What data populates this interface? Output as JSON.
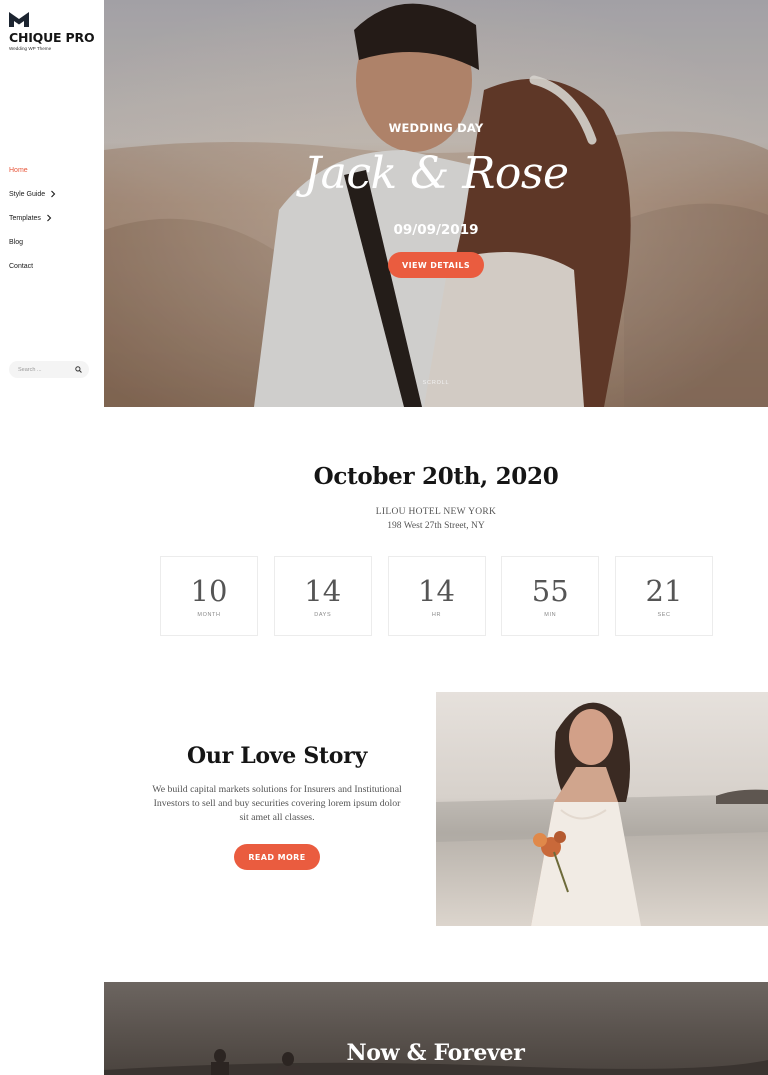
{
  "brand": {
    "name": "CHIQUE PRO",
    "tagline": "Wedding WP Theme",
    "accent": "#ea5c3f"
  },
  "nav": {
    "items": [
      {
        "label": "Home",
        "active": true,
        "has_submenu": false
      },
      {
        "label": "Style Guide",
        "active": false,
        "has_submenu": true
      },
      {
        "label": "Templates",
        "active": false,
        "has_submenu": true
      },
      {
        "label": "Blog",
        "active": false,
        "has_submenu": false
      },
      {
        "label": "Contact",
        "active": false,
        "has_submenu": false
      }
    ]
  },
  "search": {
    "placeholder": "Search ...",
    "icon": "search-icon"
  },
  "hero": {
    "eyebrow": "WEDDING DAY",
    "names": "Jack & Rose",
    "date": "09/09/2019",
    "button_label": "VIEW DETAILS",
    "scroll_label": "SCROLL"
  },
  "event": {
    "date": "October 20th, 2020",
    "venue": "LILOU HOTEL NEW YORK",
    "address": "198 West 27th Street, NY",
    "countdown": [
      {
        "value": "10",
        "label": "MONTH"
      },
      {
        "value": "14",
        "label": "DAYS"
      },
      {
        "value": "14",
        "label": "HR"
      },
      {
        "value": "55",
        "label": "MIN"
      },
      {
        "value": "21",
        "label": "SEC"
      }
    ]
  },
  "story": {
    "title": "Our Love Story",
    "body": "We build capital markets solutions for Insurers and Institutional Investors to sell and buy securities covering lorem ipsum dolor sit amet all classes.",
    "button_label": "READ MORE"
  },
  "forever": {
    "title": "Now & Forever"
  }
}
